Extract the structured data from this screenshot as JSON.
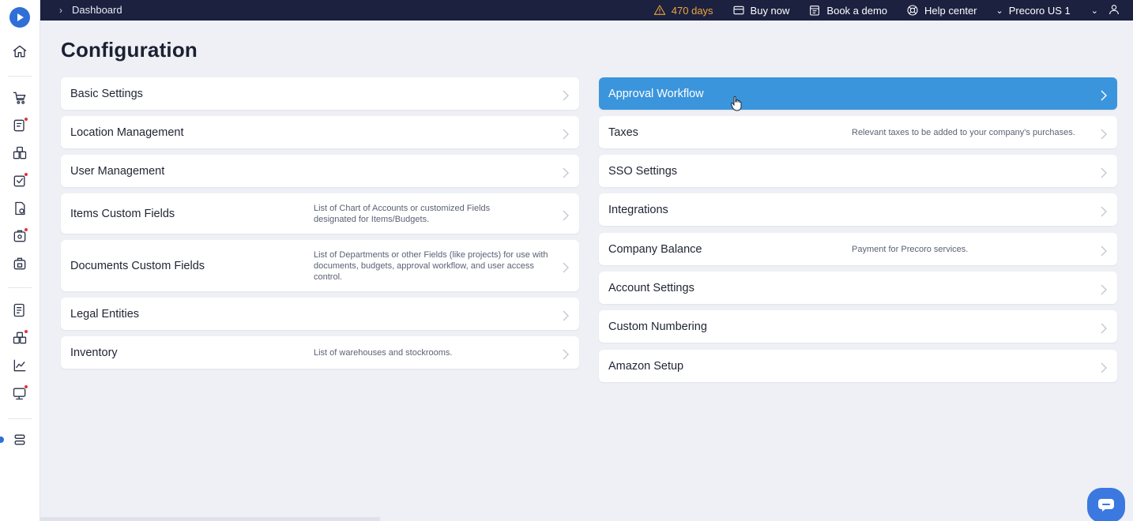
{
  "topbar": {
    "breadcrumb": "Dashboard",
    "days_left": "470 days",
    "buy_now": "Buy now",
    "book_demo": "Book a demo",
    "help_center": "Help center",
    "company": "Precoro US 1"
  },
  "page": {
    "title": "Configuration"
  },
  "left_items": [
    {
      "label": "Basic Settings",
      "desc": ""
    },
    {
      "label": "Location Management",
      "desc": ""
    },
    {
      "label": "User Management",
      "desc": ""
    },
    {
      "label": "Items Custom Fields",
      "desc": "List of Chart of Accounts or customized Fields designated for Items/Budgets."
    },
    {
      "label": "Documents Custom Fields",
      "desc": "List of Departments or other Fields (like projects) for use with documents, budgets, approval workflow, and user access control."
    },
    {
      "label": "Legal Entities",
      "desc": ""
    },
    {
      "label": "Inventory",
      "desc": "List of warehouses and stockrooms."
    }
  ],
  "right_items": [
    {
      "label": "Approval Workflow",
      "desc": "",
      "active": true
    },
    {
      "label": "Taxes",
      "desc": "Relevant taxes to be added to your company's purchases."
    },
    {
      "label": "SSO Settings",
      "desc": ""
    },
    {
      "label": "Integrations",
      "desc": ""
    },
    {
      "label": "Company Balance",
      "desc": "Payment for Precoro services."
    },
    {
      "label": "Account Settings",
      "desc": ""
    },
    {
      "label": "Custom Numbering",
      "desc": ""
    },
    {
      "label": "Amazon Setup",
      "desc": ""
    }
  ],
  "colors": {
    "accent": "#3b95dc",
    "topbar": "#1c2140",
    "warning": "#f0a43a",
    "notification": "#e0343c"
  },
  "sidebar_icons": [
    "home-icon",
    "cart-icon",
    "requests-icon",
    "orders-icon",
    "approvals-icon",
    "invoices-icon",
    "receipts-icon",
    "warehouse-icon",
    "budgets-icon",
    "suppliers-icon",
    "analytics-icon",
    "payments-icon",
    "configuration-icon"
  ]
}
